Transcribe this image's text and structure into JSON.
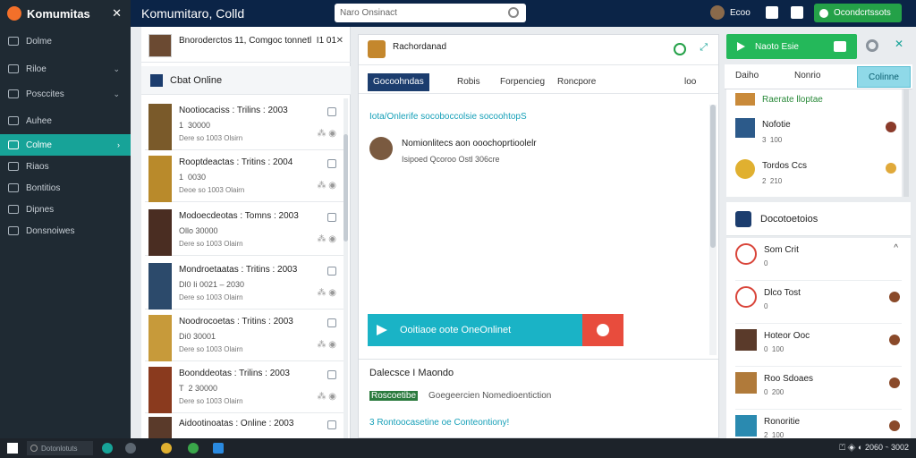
{
  "topbar": {
    "brand": "Komumitas",
    "close_glyph": "✕",
    "title": "Komumitaro, Colld",
    "search_placeholder": "Naro Onsinact",
    "user": "Ecoo",
    "cta": "Ocondcrtssots"
  },
  "sidebar": {
    "items": [
      {
        "label": "Dolme",
        "icon": "home-icon",
        "chevron": ""
      },
      {
        "label": "Riloe",
        "icon": "grid-icon",
        "chevron": "⌄"
      },
      {
        "label": "Posccites",
        "icon": "folder-icon",
        "chevron": "⌄"
      },
      {
        "label": "Auhee",
        "icon": "users-icon",
        "chevron": ""
      },
      {
        "label": "Colme",
        "icon": "chat-icon",
        "chevron": "›",
        "active": true
      },
      {
        "label": "Riaos",
        "icon": "list-icon",
        "chevron": ""
      },
      {
        "label": "Bontitios",
        "icon": "calendar-icon",
        "chevron": ""
      },
      {
        "label": "Dipnes",
        "icon": "people-icon",
        "chevron": ""
      },
      {
        "label": "Donsnoiwes",
        "icon": "settings-icon",
        "chevron": ""
      }
    ]
  },
  "list": {
    "header_title": "Bnoroderctos 11, Comgoc tonnetl",
    "header_nums": "I1  01",
    "header_close": "✕",
    "chat_online": "Cbat Online",
    "rows": [
      {
        "title": "Nootiocaciss :  Trilins : 2003",
        "sub1": "1  30000",
        "sub2": "Dere  so  1003  Olsirn",
        "thumb": "#7a5a2a"
      },
      {
        "title": "Rooptdeactas :  Tritins : 2004",
        "sub1": "1  0030",
        "sub2": "Deoe  so  1003  Olairn",
        "thumb": "#b98a2b"
      },
      {
        "title": "Modoecdeotas :  Tomns : 2003",
        "sub1": "Ollo  30000",
        "sub2": "Dere  so  1003  Olairn",
        "thumb": "#4a2d22"
      },
      {
        "title": "Mondroetaatas :  Tritins : 2003",
        "sub1": "Dl0  Ii 0021  –  2030",
        "sub2": "Dere  so  1003  Olairn",
        "thumb": "#2c4a6b"
      },
      {
        "title": "Noodrocoetas :  Tritins : 2003",
        "sub1": "Di0  30001",
        "sub2": "Dere  so  1003  Olairn",
        "thumb": "#c79a3a"
      },
      {
        "title": "Boonddeotas :  Trilins : 2003",
        "sub1": "T  2  30000",
        "sub2": "Dere  so  1003  Olairn",
        "thumb": "#8a3a1e"
      },
      {
        "title": "Aidootinoatas :  Online : 2003",
        "sub1": "",
        "sub2": "",
        "thumb": "#5a3a2a"
      }
    ]
  },
  "chat": {
    "title": "Rachordanad",
    "tabs": [
      "Gocoohndas",
      "Robis",
      "Forpencieg",
      "Roncpore",
      "loo"
    ],
    "notice": "Iota/Onlerife socoboccolsie socoohtopS",
    "msg_title": "Nomionlitecs aon  ooochoprtioolelr",
    "msg_sub": "Isipoed  Qcoroo  Ostl  306cre",
    "join": "Ooitiaoe oote OneOnlinet",
    "section_title": "Dalecsce  I  Maondo",
    "line1_key": "Roscoetibe",
    "line1_val": "Goegeercien  Nomedioentiction",
    "line2": "3  Rontoocasetine oe  Conteontiony!"
  },
  "panel": {
    "cta": "Naoto Esie",
    "tabs": [
      "Daiho",
      "Nonrio",
      "Colinne"
    ],
    "top_items": [
      {
        "name": "Raerate lloptae",
        "meta": "",
        "avatar": "#c98a3a",
        "action": "#e0a93a"
      },
      {
        "name": "Nofotie",
        "meta": "3  100",
        "avatar": "#2c5a8a",
        "action": "#8a3a2a"
      },
      {
        "name": "Tordos Ccs",
        "meta": "2  210",
        "avatar": "#e0b030",
        "action": "#e0a93a"
      }
    ],
    "ann_title": "Docotoetoios",
    "bottom_items": [
      {
        "name": "Som Crit",
        "meta": "0",
        "avatar": "#ffffff",
        "caret": "^"
      },
      {
        "name": "Dlco Tost",
        "meta": "0",
        "avatar": "#ffffff",
        "caret": ""
      },
      {
        "name": "Hoteor Ooc",
        "meta": "0  100",
        "avatar": "#5a3a2a",
        "caret": ""
      },
      {
        "name": "Roo Sdoaes",
        "meta": "0  200",
        "avatar": "#b07a3a",
        "caret": ""
      },
      {
        "name": "Ronoritie",
        "meta": "2  100",
        "avatar": "#2a8ab0",
        "caret": ""
      }
    ]
  },
  "taskbar": {
    "search": "Dotonlotuts",
    "tray": "⏍ ◈ ◐ 2060  ⌁ 3002"
  },
  "colors": {
    "topbar": "#0b2447",
    "sidebar": "#1f2a33",
    "accent_teal": "#17a398",
    "accent_green": "#24a148",
    "join_bar": "#1ab3c6",
    "end_call": "#e84c3d"
  }
}
